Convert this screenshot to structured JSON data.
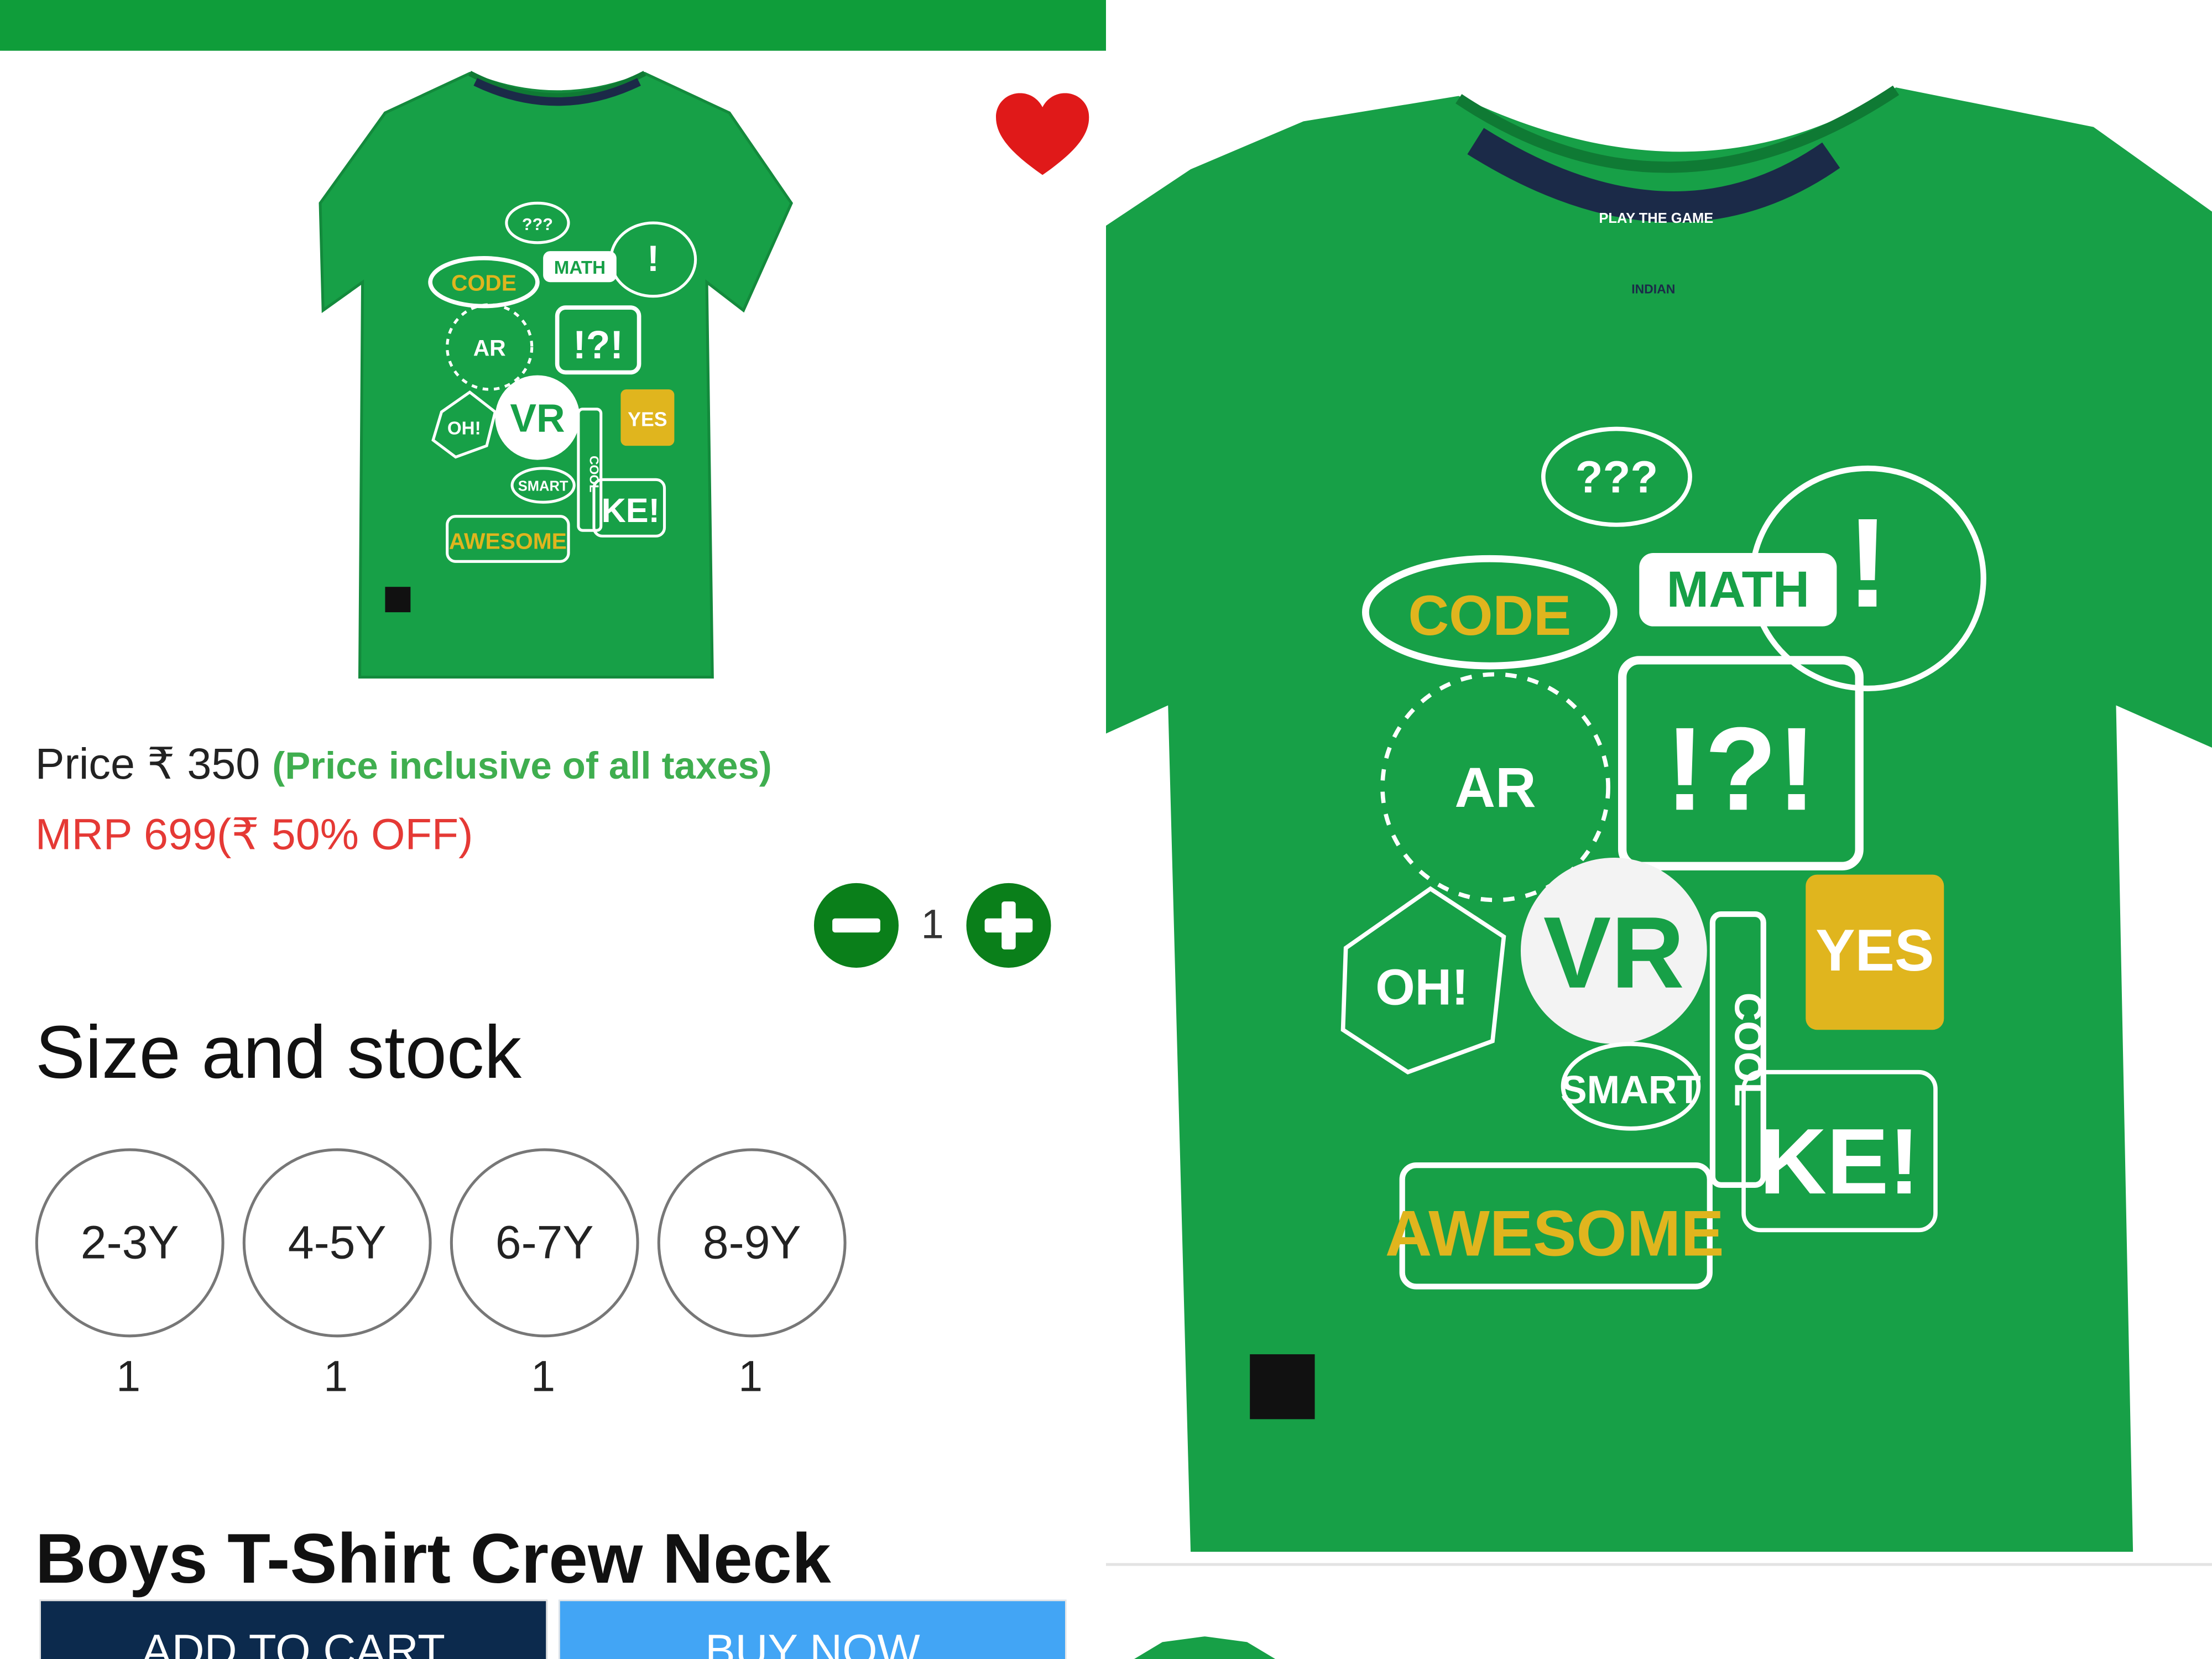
{
  "product": {
    "image_alt": "Green boys t-shirt with speech bubbles print",
    "print_words": [
      "???",
      "CODE",
      "MATH",
      "!",
      "AR",
      "!?!",
      "VR",
      "YES",
      "OH!",
      "SMART",
      "COOL",
      "KE!",
      "AWESOME"
    ],
    "collar_text": "PLAY THE GAME",
    "brand_mark": "INDIAN",
    "price_label": "Price",
    "currency_symbol": "₹",
    "price_value": "350",
    "price_note": "(Price inclusive of all taxes)",
    "mrp_text": "MRP 699(",
    "discount_text": "50% OFF)",
    "quantity": "1",
    "sizes_title": "Size and stock",
    "sizes": [
      {
        "label": "2-3Y",
        "stock": "1"
      },
      {
        "label": "4-5Y",
        "stock": "1"
      },
      {
        "label": "6-7Y",
        "stock": "1"
      },
      {
        "label": "8-9Y",
        "stock": "1"
      }
    ],
    "title": "Boys T-Shirt Crew Neck"
  },
  "actions": {
    "add_to_cart": "ADD TO CART",
    "buy_now": "BUY NOW"
  },
  "icons": {
    "wishlist": "heart-icon",
    "decrease": "minus-circle-icon",
    "increase": "plus-circle-icon"
  },
  "colors": {
    "appbar": "#0f9d3a",
    "shirt": "#17a047",
    "heart": "#e01919",
    "qty_buttons": "#0a7f1a",
    "price_note": "#3fae4f",
    "mrp": "#e53935",
    "add_to_cart_bg": "#0c2a4d",
    "buy_now_bg": "#42a5f5"
  }
}
